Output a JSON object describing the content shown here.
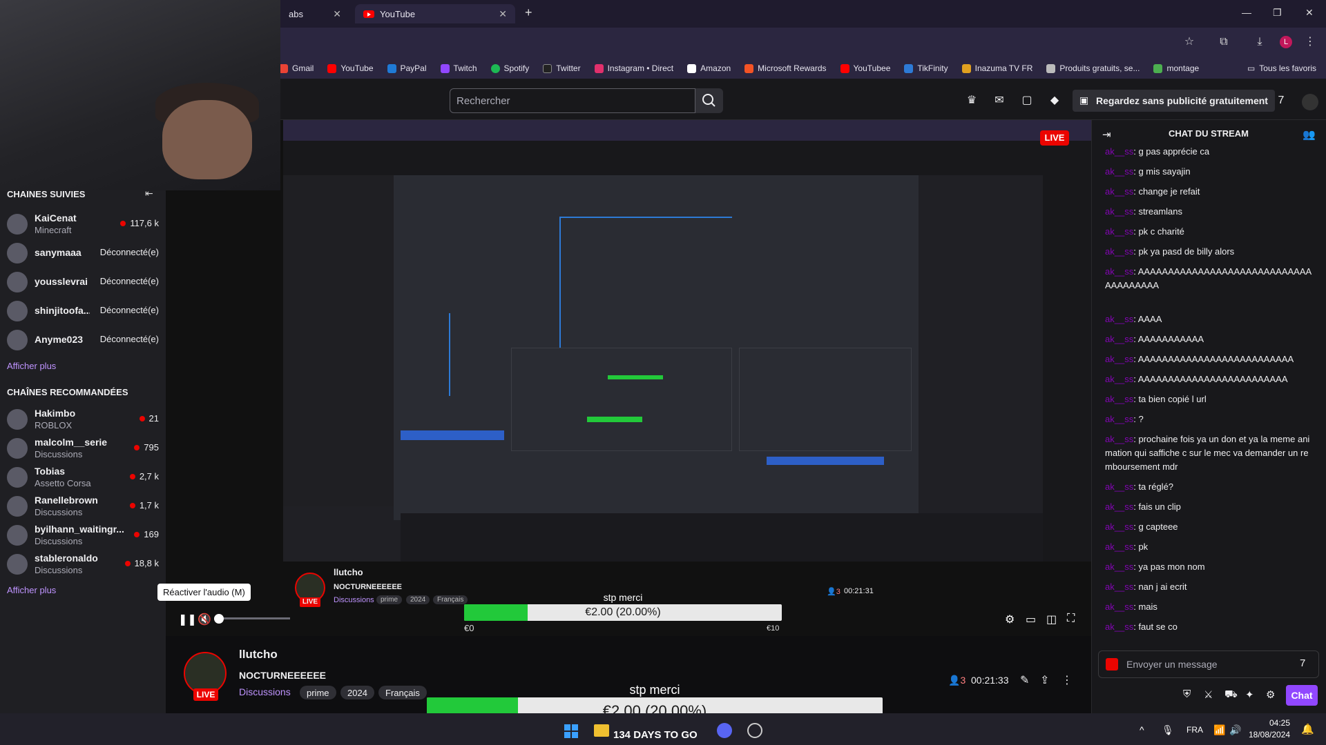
{
  "browser": {
    "tabs": [
      {
        "label": "abs"
      },
      {
        "label": "YouTube"
      }
    ],
    "new_tab": "+",
    "bookmarks": [
      {
        "label": "Gmail",
        "color": "#ea4335"
      },
      {
        "label": "YouTube",
        "color": "#ff0000"
      },
      {
        "label": "PayPal",
        "color": "#1f7ad6"
      },
      {
        "label": "Twitch",
        "color": "#9147ff"
      },
      {
        "label": "Spotify",
        "color": "#1db954"
      },
      {
        "label": "Twitter",
        "color": "#222222"
      },
      {
        "label": "Instagram • Direct",
        "color": "#e1306c"
      },
      {
        "label": "Amazon",
        "color": "#ffffff"
      },
      {
        "label": "Microsoft Rewards",
        "color": "#f35325"
      },
      {
        "label": "YouTubee",
        "color": "#ff0000"
      },
      {
        "label": "TikFinity",
        "color": "#2d7ad6"
      },
      {
        "label": "Inazuma TV FR",
        "color": "#e0a020"
      },
      {
        "label": "Produits gratuits, se...",
        "color": "#bbbbbb"
      },
      {
        "label": "montage",
        "color": "#4caf50"
      }
    ],
    "all_bookmarks": "Tous les favoris",
    "profile_initial": "L"
  },
  "twitch": {
    "search_placeholder": "Rechercher",
    "prime_cta": "Regardez sans publicité gratuitement"
  },
  "sidebar": {
    "followed_title": "CHAÎNES SUIVIES",
    "followed": [
      {
        "name": "KaiCenat",
        "game": "Minecraft",
        "viewers": "117,6 k",
        "live": true
      },
      {
        "name": "sanymaaa",
        "status": "Déconnecté(e)",
        "live": false
      },
      {
        "name": "yousslevrai",
        "status": "Déconnecté(e)",
        "live": false
      },
      {
        "name": "shinjitoofa...",
        "status": "Déconnecté(e)",
        "live": false
      },
      {
        "name": "Anyme023",
        "status": "Déconnecté(e)",
        "live": false
      }
    ],
    "show_more": "Afficher plus",
    "recommended_title": "CHAÎNES RECOMMANDÉES",
    "recommended": [
      {
        "name": "Hakimbo",
        "game": "ROBLOX",
        "viewers": "21"
      },
      {
        "name": "malcolm__serie",
        "game": "Discussions",
        "viewers": "795"
      },
      {
        "name": "Tobias",
        "game": "Assetto Corsa",
        "viewers": "2,7 k"
      },
      {
        "name": "Ranellebrown",
        "game": "Discussions",
        "viewers": "1,7 k"
      },
      {
        "name": "byilhann_waitingr...",
        "game": "Discussions",
        "viewers": "169"
      },
      {
        "name": "stableronaldo",
        "game": "Discussions",
        "viewers": "18,8 k"
      }
    ],
    "show_more_2": "Afficher plus"
  },
  "player": {
    "live_badge": "LIVE",
    "tooltip": "Réactiver l'audio (M)",
    "volume_level": 0,
    "overlay_name": "llutcho",
    "overlay_title": "NOCTURNEEEEEE",
    "overlay_tags": [
      "Discussions",
      "prime",
      "2024",
      "Français"
    ],
    "overlay_viewers": "3",
    "overlay_uptime": "00:21:31",
    "donation": {
      "message": "stp merci",
      "current": "€2.00 (20.00%)",
      "progress_percent": 20,
      "min": "€0",
      "max": "€10",
      "countdown": "134 DAYS TO GO"
    }
  },
  "stream": {
    "channel": "llutcho",
    "title": "NOCTURNEEEEEE",
    "category": "Discussions",
    "tags": [
      "prime",
      "2024",
      "Français"
    ],
    "live_badge": "LIVE",
    "viewers": "3",
    "uptime": "00:21:33"
  },
  "chat": {
    "title": "CHAT DU STREAM",
    "user": "ak__ss",
    "messages": [
      "g pas apprécie ca",
      "g mis sayajin",
      "change je refait",
      "streamlans",
      "pk c charité",
      "pk ya pasd de billy alors",
      "AAAAAAAAAAAAAAAAAAAAAAAAAAAAAAAAAAAAAA",
      "AAAA",
      "AAAAAAAAAAA",
      "AAAAAAAAAAAAAAAAAAAAAAAAAA",
      "AAAAAAAAAAAAAAAAAAAAAAAAA",
      "ta bien copié l url",
      "?",
      "prochaine fois ya un don et ya la meme animation qui saffiche c sur le mec va demander un remboursement mdr",
      "ta réglé?",
      "fais un clip",
      "g capteee",
      "pk",
      "ya pas mon nom",
      "nan j ai ecrit",
      "mais",
      "faut se co"
    ],
    "input_placeholder": "Envoyer un message",
    "chat_button": "Chat"
  },
  "taskbar": {
    "lang": "FRA",
    "time": "04:25",
    "date": "18/08/2024"
  }
}
